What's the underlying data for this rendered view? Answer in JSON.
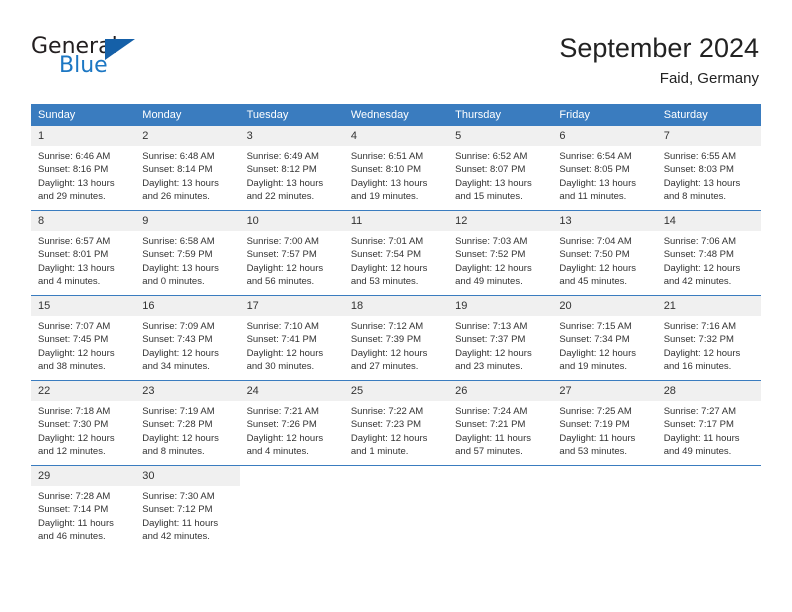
{
  "brand": {
    "name_part1": "General",
    "name_part2": "Blue",
    "triangle_icon": "triangle-icon"
  },
  "header": {
    "title": "September 2024",
    "location": "Faid, Germany"
  },
  "calendar": {
    "weekday_headers": [
      "Sunday",
      "Monday",
      "Tuesday",
      "Wednesday",
      "Thursday",
      "Friday",
      "Saturday"
    ],
    "labels": {
      "sunrise": "Sunrise:",
      "sunset": "Sunset:",
      "daylight": "Daylight:"
    },
    "weeks": [
      [
        {
          "day": "1",
          "sunrise": "Sunrise: 6:46 AM",
          "sunset": "Sunset: 8:16 PM",
          "daylight_line1": "Daylight: 13 hours",
          "daylight_line2": "and 29 minutes."
        },
        {
          "day": "2",
          "sunrise": "Sunrise: 6:48 AM",
          "sunset": "Sunset: 8:14 PM",
          "daylight_line1": "Daylight: 13 hours",
          "daylight_line2": "and 26 minutes."
        },
        {
          "day": "3",
          "sunrise": "Sunrise: 6:49 AM",
          "sunset": "Sunset: 8:12 PM",
          "daylight_line1": "Daylight: 13 hours",
          "daylight_line2": "and 22 minutes."
        },
        {
          "day": "4",
          "sunrise": "Sunrise: 6:51 AM",
          "sunset": "Sunset: 8:10 PM",
          "daylight_line1": "Daylight: 13 hours",
          "daylight_line2": "and 19 minutes."
        },
        {
          "day": "5",
          "sunrise": "Sunrise: 6:52 AM",
          "sunset": "Sunset: 8:07 PM",
          "daylight_line1": "Daylight: 13 hours",
          "daylight_line2": "and 15 minutes."
        },
        {
          "day": "6",
          "sunrise": "Sunrise: 6:54 AM",
          "sunset": "Sunset: 8:05 PM",
          "daylight_line1": "Daylight: 13 hours",
          "daylight_line2": "and 11 minutes."
        },
        {
          "day": "7",
          "sunrise": "Sunrise: 6:55 AM",
          "sunset": "Sunset: 8:03 PM",
          "daylight_line1": "Daylight: 13 hours",
          "daylight_line2": "and 8 minutes."
        }
      ],
      [
        {
          "day": "8",
          "sunrise": "Sunrise: 6:57 AM",
          "sunset": "Sunset: 8:01 PM",
          "daylight_line1": "Daylight: 13 hours",
          "daylight_line2": "and 4 minutes."
        },
        {
          "day": "9",
          "sunrise": "Sunrise: 6:58 AM",
          "sunset": "Sunset: 7:59 PM",
          "daylight_line1": "Daylight: 13 hours",
          "daylight_line2": "and 0 minutes."
        },
        {
          "day": "10",
          "sunrise": "Sunrise: 7:00 AM",
          "sunset": "Sunset: 7:57 PM",
          "daylight_line1": "Daylight: 12 hours",
          "daylight_line2": "and 56 minutes."
        },
        {
          "day": "11",
          "sunrise": "Sunrise: 7:01 AM",
          "sunset": "Sunset: 7:54 PM",
          "daylight_line1": "Daylight: 12 hours",
          "daylight_line2": "and 53 minutes."
        },
        {
          "day": "12",
          "sunrise": "Sunrise: 7:03 AM",
          "sunset": "Sunset: 7:52 PM",
          "daylight_line1": "Daylight: 12 hours",
          "daylight_line2": "and 49 minutes."
        },
        {
          "day": "13",
          "sunrise": "Sunrise: 7:04 AM",
          "sunset": "Sunset: 7:50 PM",
          "daylight_line1": "Daylight: 12 hours",
          "daylight_line2": "and 45 minutes."
        },
        {
          "day": "14",
          "sunrise": "Sunrise: 7:06 AM",
          "sunset": "Sunset: 7:48 PM",
          "daylight_line1": "Daylight: 12 hours",
          "daylight_line2": "and 42 minutes."
        }
      ],
      [
        {
          "day": "15",
          "sunrise": "Sunrise: 7:07 AM",
          "sunset": "Sunset: 7:45 PM",
          "daylight_line1": "Daylight: 12 hours",
          "daylight_line2": "and 38 minutes."
        },
        {
          "day": "16",
          "sunrise": "Sunrise: 7:09 AM",
          "sunset": "Sunset: 7:43 PM",
          "daylight_line1": "Daylight: 12 hours",
          "daylight_line2": "and 34 minutes."
        },
        {
          "day": "17",
          "sunrise": "Sunrise: 7:10 AM",
          "sunset": "Sunset: 7:41 PM",
          "daylight_line1": "Daylight: 12 hours",
          "daylight_line2": "and 30 minutes."
        },
        {
          "day": "18",
          "sunrise": "Sunrise: 7:12 AM",
          "sunset": "Sunset: 7:39 PM",
          "daylight_line1": "Daylight: 12 hours",
          "daylight_line2": "and 27 minutes."
        },
        {
          "day": "19",
          "sunrise": "Sunrise: 7:13 AM",
          "sunset": "Sunset: 7:37 PM",
          "daylight_line1": "Daylight: 12 hours",
          "daylight_line2": "and 23 minutes."
        },
        {
          "day": "20",
          "sunrise": "Sunrise: 7:15 AM",
          "sunset": "Sunset: 7:34 PM",
          "daylight_line1": "Daylight: 12 hours",
          "daylight_line2": "and 19 minutes."
        },
        {
          "day": "21",
          "sunrise": "Sunrise: 7:16 AM",
          "sunset": "Sunset: 7:32 PM",
          "daylight_line1": "Daylight: 12 hours",
          "daylight_line2": "and 16 minutes."
        }
      ],
      [
        {
          "day": "22",
          "sunrise": "Sunrise: 7:18 AM",
          "sunset": "Sunset: 7:30 PM",
          "daylight_line1": "Daylight: 12 hours",
          "daylight_line2": "and 12 minutes."
        },
        {
          "day": "23",
          "sunrise": "Sunrise: 7:19 AM",
          "sunset": "Sunset: 7:28 PM",
          "daylight_line1": "Daylight: 12 hours",
          "daylight_line2": "and 8 minutes."
        },
        {
          "day": "24",
          "sunrise": "Sunrise: 7:21 AM",
          "sunset": "Sunset: 7:26 PM",
          "daylight_line1": "Daylight: 12 hours",
          "daylight_line2": "and 4 minutes."
        },
        {
          "day": "25",
          "sunrise": "Sunrise: 7:22 AM",
          "sunset": "Sunset: 7:23 PM",
          "daylight_line1": "Daylight: 12 hours",
          "daylight_line2": "and 1 minute."
        },
        {
          "day": "26",
          "sunrise": "Sunrise: 7:24 AM",
          "sunset": "Sunset: 7:21 PM",
          "daylight_line1": "Daylight: 11 hours",
          "daylight_line2": "and 57 minutes."
        },
        {
          "day": "27",
          "sunrise": "Sunrise: 7:25 AM",
          "sunset": "Sunset: 7:19 PM",
          "daylight_line1": "Daylight: 11 hours",
          "daylight_line2": "and 53 minutes."
        },
        {
          "day": "28",
          "sunrise": "Sunrise: 7:27 AM",
          "sunset": "Sunset: 7:17 PM",
          "daylight_line1": "Daylight: 11 hours",
          "daylight_line2": "and 49 minutes."
        }
      ],
      [
        {
          "day": "29",
          "sunrise": "Sunrise: 7:28 AM",
          "sunset": "Sunset: 7:14 PM",
          "daylight_line1": "Daylight: 11 hours",
          "daylight_line2": "and 46 minutes."
        },
        {
          "day": "30",
          "sunrise": "Sunrise: 7:30 AM",
          "sunset": "Sunset: 7:12 PM",
          "daylight_line1": "Daylight: 11 hours",
          "daylight_line2": "and 42 minutes."
        },
        {
          "day": "",
          "sunrise": "",
          "sunset": "",
          "daylight_line1": "",
          "daylight_line2": ""
        },
        {
          "day": "",
          "sunrise": "",
          "sunset": "",
          "daylight_line1": "",
          "daylight_line2": ""
        },
        {
          "day": "",
          "sunrise": "",
          "sunset": "",
          "daylight_line1": "",
          "daylight_line2": ""
        },
        {
          "day": "",
          "sunrise": "",
          "sunset": "",
          "daylight_line1": "",
          "daylight_line2": ""
        },
        {
          "day": "",
          "sunrise": "",
          "sunset": "",
          "daylight_line1": "",
          "daylight_line2": ""
        }
      ]
    ]
  },
  "colors": {
    "header_blue": "#3a7cbf",
    "brand_blue": "#1c77c3",
    "daynum_bg": "#f0f0f0",
    "text": "#333333"
  }
}
